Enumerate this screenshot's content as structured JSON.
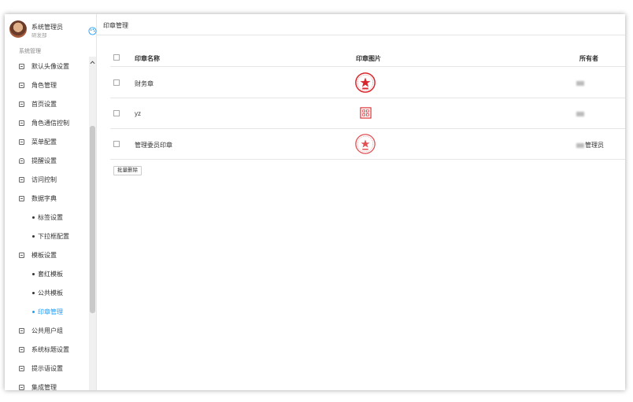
{
  "user": {
    "name": "系统管理员",
    "dept": "研发部"
  },
  "sidebar": {
    "section_title": "系统管理",
    "items": [
      {
        "label": "默认头像设置"
      },
      {
        "label": "角色管理"
      },
      {
        "label": "首页设置"
      },
      {
        "label": "角色通信控制"
      },
      {
        "label": "菜单配置"
      },
      {
        "label": "提醒设置"
      },
      {
        "label": "访问控制"
      },
      {
        "label": "数据字典"
      },
      {
        "label": "标签设置"
      },
      {
        "label": "下拉框配置"
      },
      {
        "label": "模板设置"
      },
      {
        "label": "套红模板"
      },
      {
        "label": "公共模板"
      },
      {
        "label": "印章管理"
      },
      {
        "label": "公共用户组"
      },
      {
        "label": "系统标题设置"
      },
      {
        "label": "提示语设置"
      },
      {
        "label": "集成管理"
      }
    ]
  },
  "main": {
    "page_title": "印章管理",
    "columns": [
      "印章名称",
      "印章图片",
      "所有者"
    ],
    "rows": [
      {
        "name": "财务章",
        "owner": ""
      },
      {
        "name": "yz",
        "owner": ""
      },
      {
        "name": "管理委员印章",
        "owner": "管理员"
      }
    ],
    "batch_delete": "批量删除"
  },
  "colors": {
    "accent": "#1e9fff",
    "seal_red": "#d9262b"
  }
}
